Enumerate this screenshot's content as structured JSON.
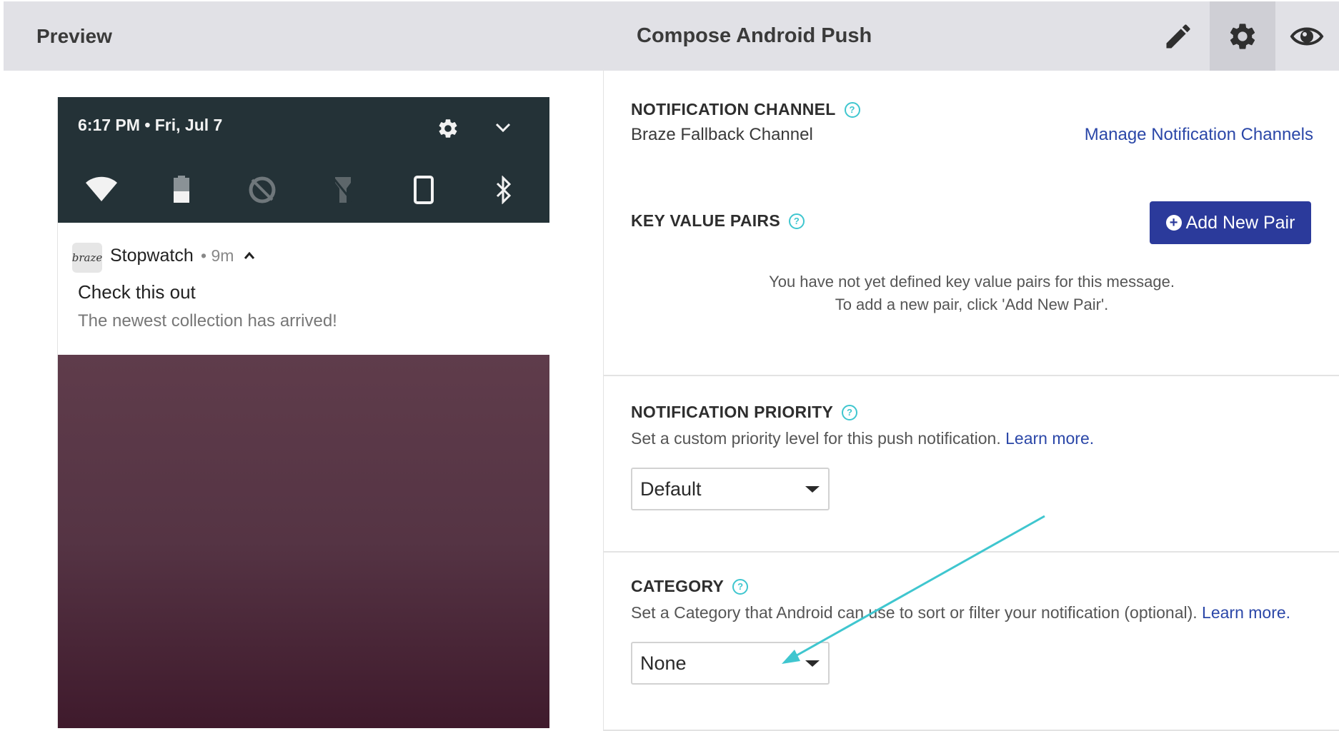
{
  "header": {
    "left_title": "Preview",
    "center_title": "Compose Android Push",
    "buttons": [
      {
        "icon": "pencil-icon",
        "active": false
      },
      {
        "icon": "gear-icon",
        "active": true
      },
      {
        "icon": "eye-icon",
        "active": false
      }
    ]
  },
  "preview": {
    "status_time": "6:17 PM • Fri, Jul 7",
    "quick_settings": [
      "wifi-icon",
      "battery-icon",
      "data-saver-off-icon",
      "flashlight-off-icon",
      "rotation-icon",
      "bluetooth-icon"
    ],
    "notification": {
      "app_badge": "braze",
      "app_name": "Stopwatch",
      "time": "• 9m",
      "title": "Check this out",
      "body": "The newest collection has arrived!"
    }
  },
  "settings": {
    "notification_channel": {
      "title": "NOTIFICATION CHANNEL",
      "value": "Braze Fallback Channel",
      "manage_link": "Manage Notification Channels"
    },
    "key_value_pairs": {
      "title": "KEY VALUE PAIRS",
      "add_button": "Add New Pair",
      "empty_line1": "You have not yet defined key value pairs for this message.",
      "empty_line2": "To add a new pair, click 'Add New Pair'."
    },
    "notification_priority": {
      "title": "NOTIFICATION PRIORITY",
      "description": "Set a custom priority level for this push notification.",
      "learn_more": "Learn more.",
      "selected": "Default"
    },
    "category": {
      "title": "CATEGORY",
      "description": "Set a Category that Android can use to sort or filter your notification (optional).",
      "learn_more": "Learn more.",
      "selected": "None"
    }
  },
  "colors": {
    "accent_link": "#2b47a8",
    "button": "#2b3a9b",
    "help_icon": "#3fc6cf",
    "annotation_arrow": "#3fc6cf"
  }
}
